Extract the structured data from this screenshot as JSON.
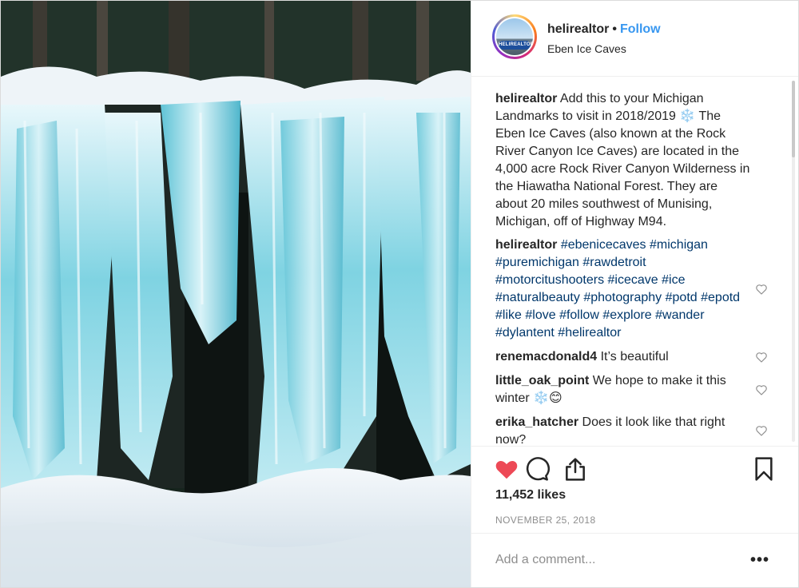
{
  "post": {
    "username": "helirealtor",
    "follow_label": "Follow",
    "location": "Eben Ice Caves",
    "avatar_badge_text": "HELIREALTOR"
  },
  "caption": {
    "author": "helirealtor",
    "text": " Add this to your Michigan Landmarks to visit in 2018/2019 ❄️ The Eben Ice Caves (also known at the Rock River Canyon Ice Caves) are located in the 4,000 acre Rock River Canyon Wilderness in the Hiawatha National Forest. They are about 20 miles southwest of Munising, Michigan, off of Highway M94."
  },
  "hashtag_comment": {
    "author": "helirealtor",
    "hashtags": [
      "#ebenicecaves",
      "#michigan",
      "#puremichigan",
      "#rawdetroit",
      "#motorcitushooters",
      "#icecave",
      "#ice",
      "#naturalbeauty",
      "#photography",
      "#potd",
      "#epotd",
      "#like",
      "#love",
      "#follow",
      "#explore",
      "#wander",
      "#dylantent",
      "#helirealtor"
    ]
  },
  "comments": [
    {
      "author": "renemacdonald4",
      "text": " It’s beautiful"
    },
    {
      "author": "little_oak_point",
      "text": " We hope to make it this winter ❄️😊"
    },
    {
      "author": "erika_hatcher",
      "text": " Does it look like that right now?"
    }
  ],
  "actions": {
    "like_icon": "heart-filled-icon",
    "comment_icon": "comment-bubble-icon",
    "share_icon": "share-upload-icon",
    "save_icon": "bookmark-icon",
    "like_color": "#ed4956"
  },
  "likes_text": "11,452 likes",
  "date_text": "November 25, 2018",
  "comment_input": {
    "placeholder": "Add a comment...",
    "more_label": "•••"
  }
}
